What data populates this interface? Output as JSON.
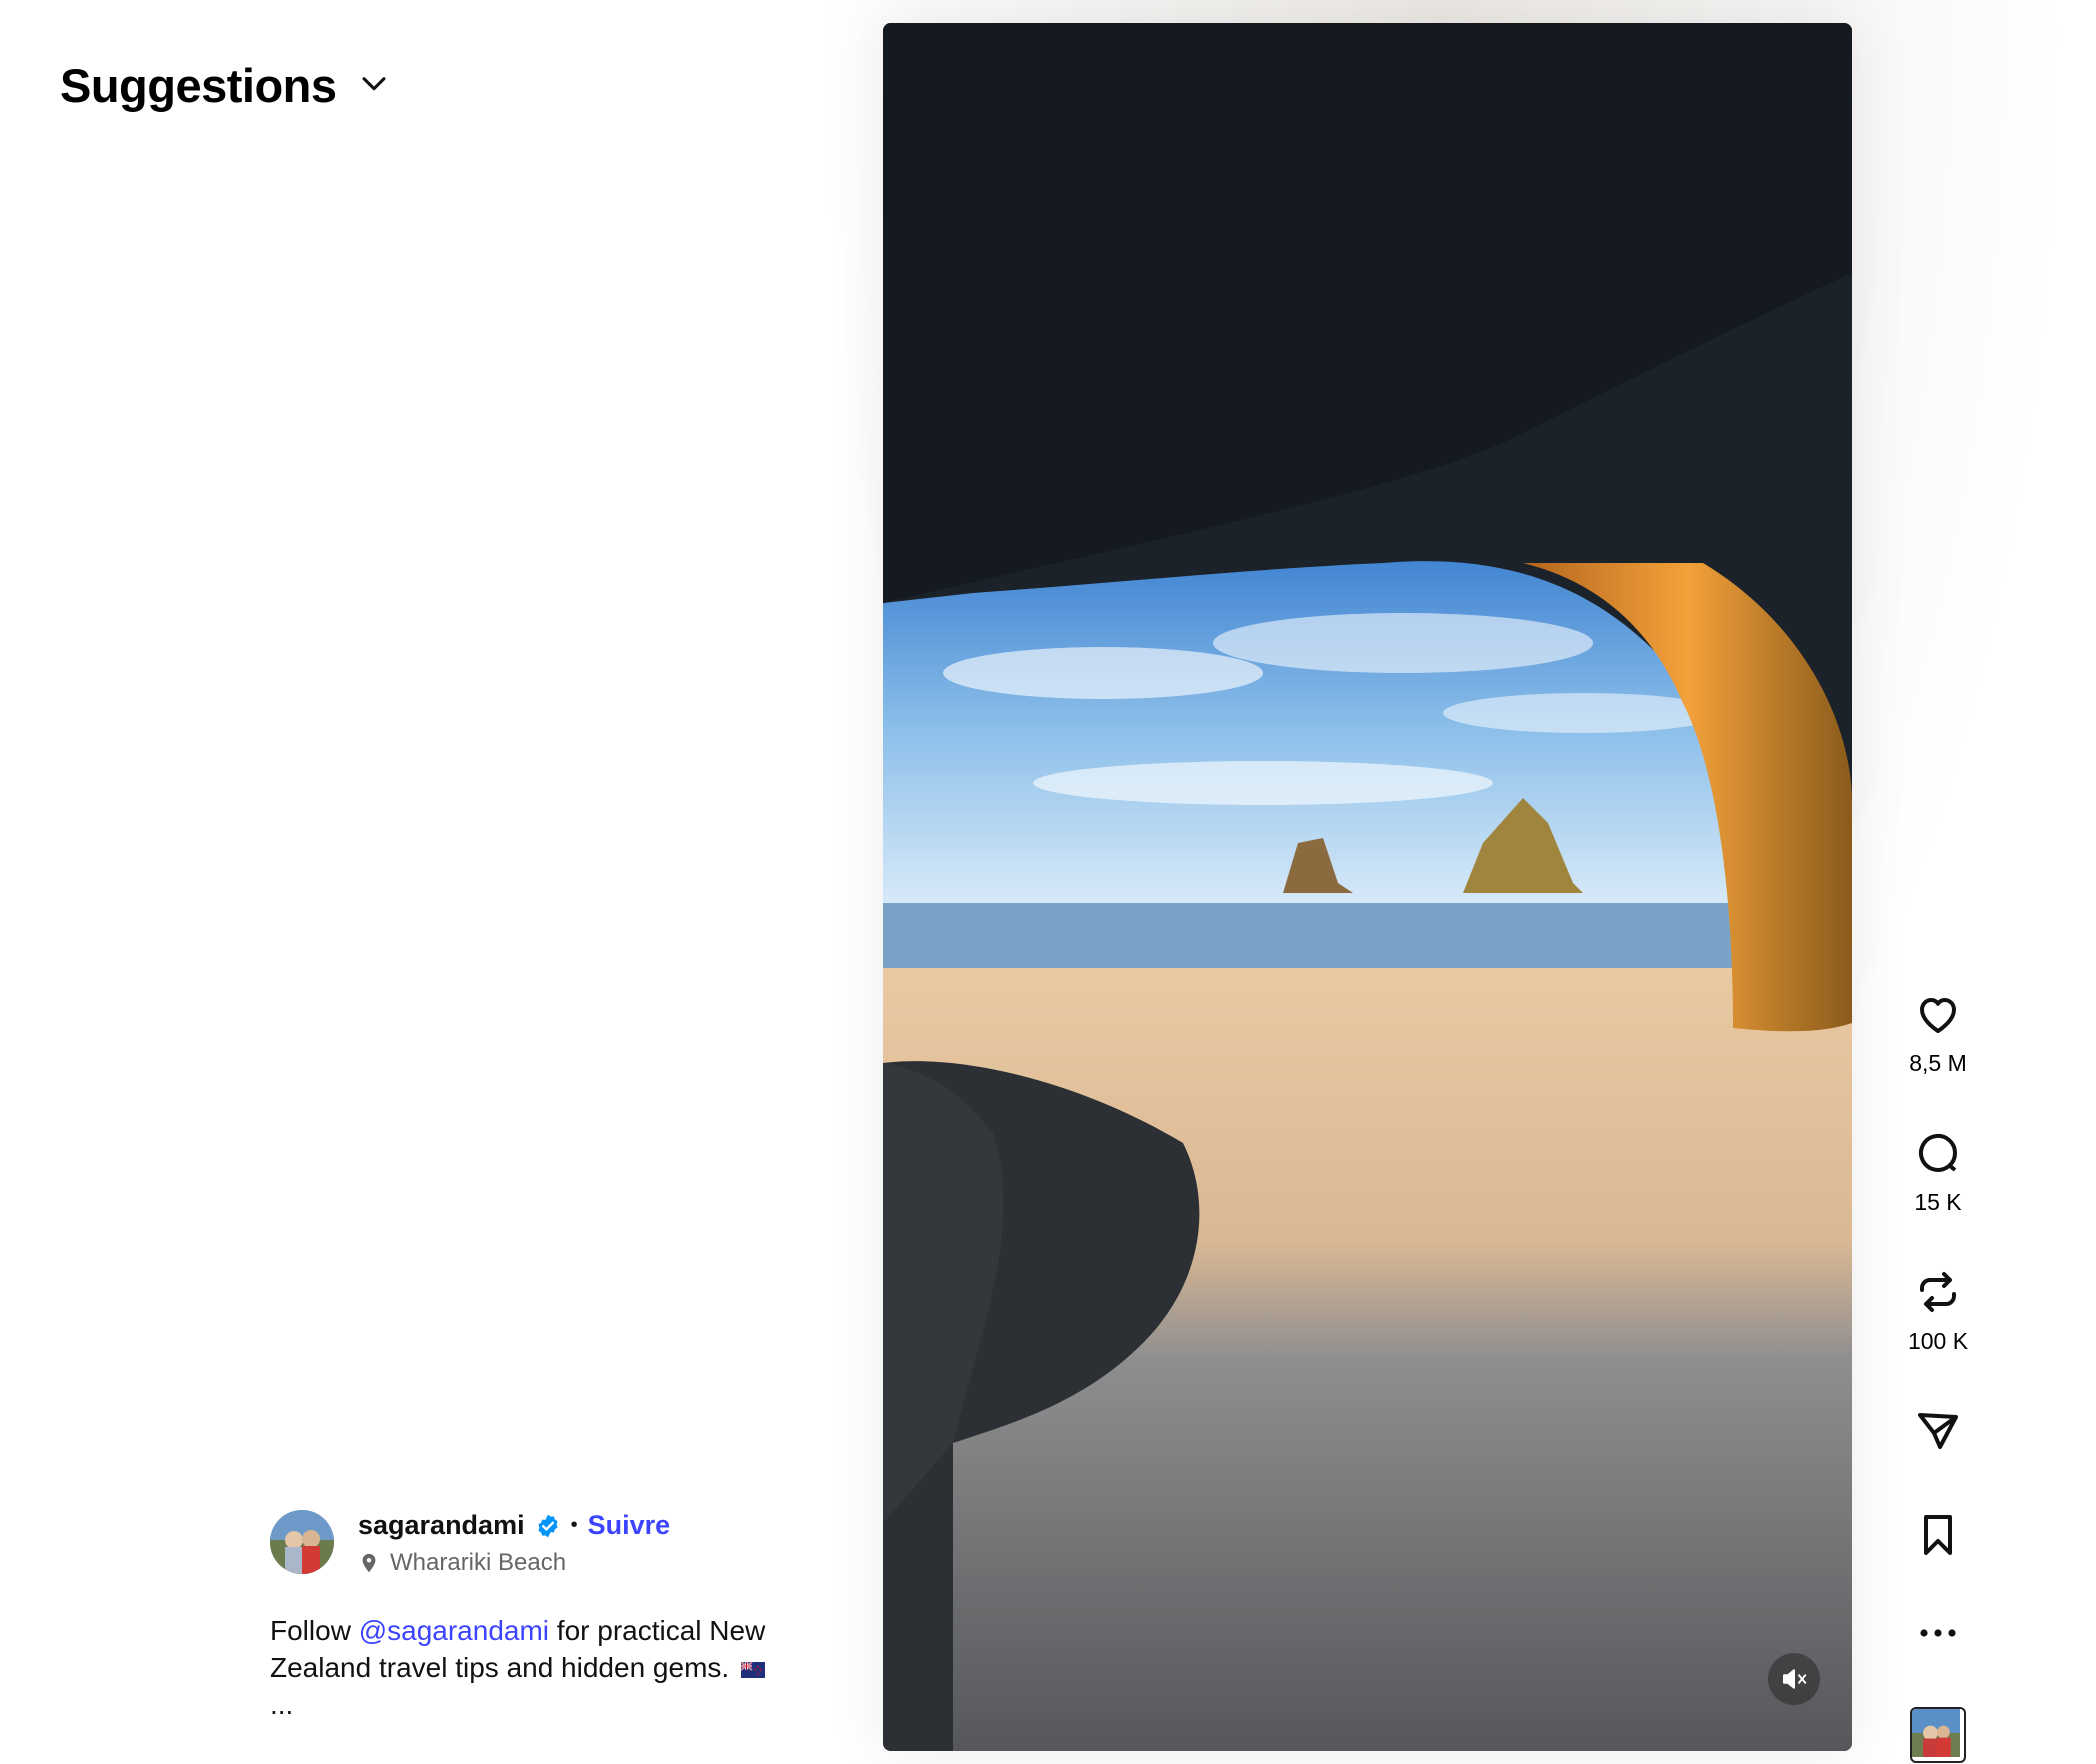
{
  "header": {
    "title": "Suggestions"
  },
  "post": {
    "username": "sagarandami",
    "follow_label": "Suivre",
    "separator": "•",
    "location": "Wharariki Beach",
    "caption": {
      "prefix": "Follow ",
      "mention": "@sagarandami",
      "suffix": " for practical New Zealand travel tips and hidden gems.",
      "more": "..."
    }
  },
  "actions": {
    "likes": "8,5 M",
    "comments": "15 K",
    "reposts": "100 K"
  },
  "icons": {
    "dropdown": "chevron-down-icon",
    "verified": "verified-badge-icon",
    "location": "location-pin-icon",
    "like": "heart-icon",
    "comment": "comment-bubble-icon",
    "repost": "repost-icon",
    "share": "send-icon",
    "save": "bookmark-icon",
    "more": "more-dots-icon",
    "mute": "speaker-muted-icon"
  },
  "colors": {
    "link": "#3d44ff",
    "verified": "#0095f6",
    "text": "#111111",
    "secondary": "#666666"
  }
}
